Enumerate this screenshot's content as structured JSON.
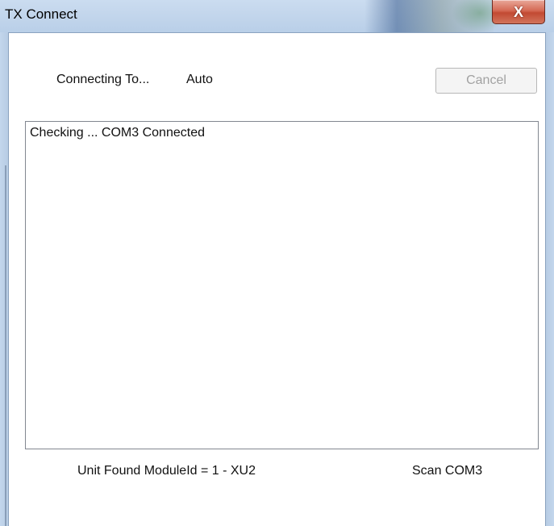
{
  "window": {
    "title": "TX Connect",
    "close_label": "X",
    "close_icon": "close-icon"
  },
  "header": {
    "connecting_label": "Connecting To...",
    "connecting_value": "Auto",
    "cancel_label": "Cancel",
    "cancel_enabled": false
  },
  "log": {
    "lines": [
      "Checking ... COM3 Connected"
    ]
  },
  "status": {
    "unit_found": "Unit Found ModuleId = 1 - XU2",
    "scan": "Scan COM3"
  }
}
